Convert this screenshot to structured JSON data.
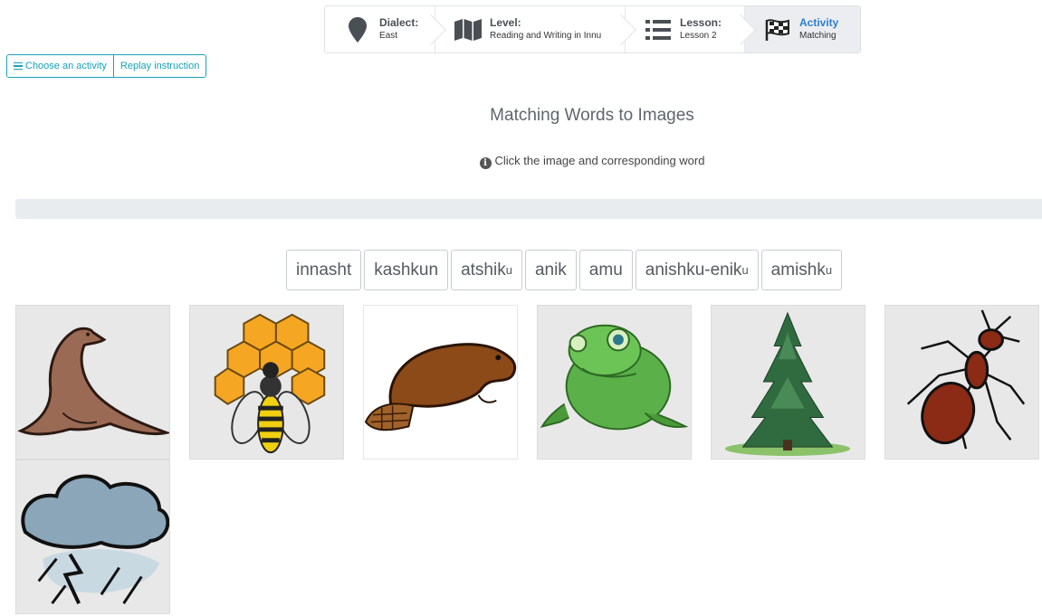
{
  "breadcrumb": [
    {
      "title": "Dialect:",
      "value": "East"
    },
    {
      "title": "Level:",
      "value": "Reading and Writing in Innu"
    },
    {
      "title": "Lesson:",
      "value": "Lesson 2"
    },
    {
      "title": "Activity",
      "value": "Matching"
    }
  ],
  "toolbar": {
    "choose_label": "Choose an activity",
    "replay_label": "Replay instruction"
  },
  "activity": {
    "title": "Matching Words to Images",
    "instruction": "Click the image and corresponding word"
  },
  "words": [
    {
      "base": "innasht",
      "sup": ""
    },
    {
      "base": "kashkun",
      "sup": ""
    },
    {
      "base": "atshik",
      "sup": "u"
    },
    {
      "base": "anik",
      "sup": ""
    },
    {
      "base": "amu",
      "sup": ""
    },
    {
      "base": "anishku-enik",
      "sup": "u"
    },
    {
      "base": "amishk",
      "sup": "u"
    }
  ],
  "images": [
    "seal",
    "bee",
    "beaver",
    "frog",
    "tree",
    "ant",
    "storm-cloud"
  ],
  "colors": {
    "accent": "#17a2b8",
    "active": "#2d7fd1"
  }
}
